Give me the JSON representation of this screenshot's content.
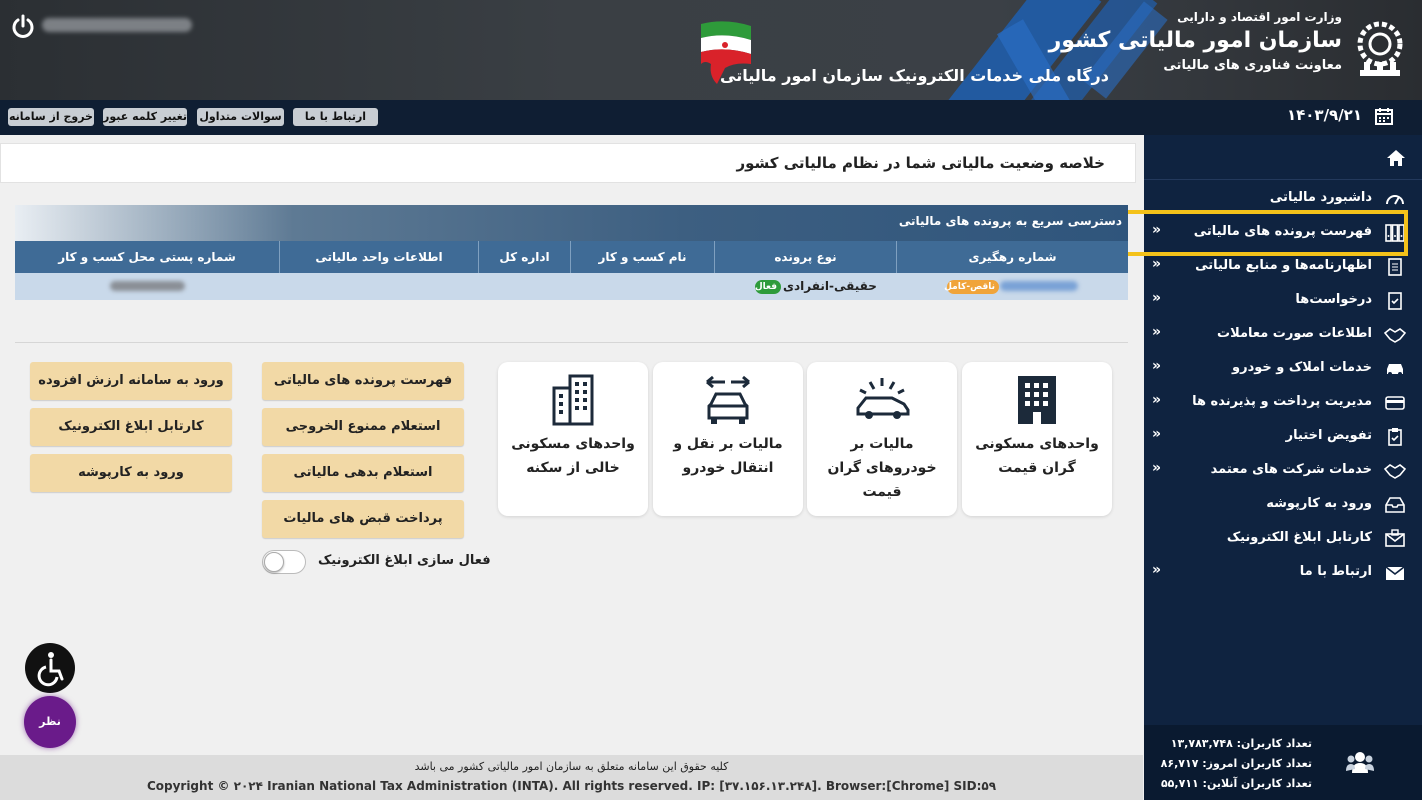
{
  "header": {
    "portal_title": "درگاه ملی خدمات الکترونیک سازمان امور مالیاتی",
    "org_ministry": "وزارت امور اقتصاد و دارایی",
    "org_name": "سازمان امور مالیاتی کشور",
    "org_deputy": "معاونت فناوری های مالیاتی"
  },
  "toolbar": {
    "contact_label": "ارتباط با ما",
    "faq_label": "سوالات متداول",
    "change_password_label": "تغییر کلمه عبور",
    "logout_label": "خروج از سامانه",
    "date": "۱۴۰۳/۹/۲۱"
  },
  "sidebar": {
    "items": [
      {
        "label": "داشبورد مالیاتی",
        "icon": "dashboard-icon",
        "chevron": false
      },
      {
        "label": "فهرست پرونده های مالیاتی",
        "icon": "binders-icon",
        "chevron": true
      },
      {
        "label": "اظهارنامه‌ها و منابع مالیاتی",
        "icon": "document-icon",
        "chevron": true
      },
      {
        "label": "درخواست‌ها",
        "icon": "request-icon",
        "chevron": true
      },
      {
        "label": "اطلاعات صورت معاملات",
        "icon": "handshake-icon",
        "chevron": true
      },
      {
        "label": "خدمات املاک و خودرو",
        "icon": "car-icon",
        "chevron": true
      },
      {
        "label": "مدیریت پرداخت و پذیرنده ها",
        "icon": "card-icon",
        "chevron": true
      },
      {
        "label": "تفویض اختیار",
        "icon": "clipboard-check-icon",
        "chevron": true
      },
      {
        "label": "خدمات شرکت های معتمد",
        "icon": "handshake-icon",
        "chevron": true
      },
      {
        "label": "ورود به کارپوشه",
        "icon": "inbox-icon",
        "chevron": false
      },
      {
        "label": "کارتابل ابلاغ الکترونیک",
        "icon": "mail-lock-icon",
        "chevron": false
      },
      {
        "label": "ارتباط با ما",
        "icon": "envelope-icon",
        "chevron": true
      }
    ],
    "stats": {
      "users_total": "تعداد کاربران: ۱۳,۷۸۳,۷۴۸",
      "users_today": "تعداد کاربران امروز: ۸۶,۷۱۷",
      "users_online": "تعداد کاربران آنلاین: ۵۵,۷۱۱"
    }
  },
  "main": {
    "summary_title": "خلاصه وضعیت مالیاتی شما در نظام مالیاتی کشور",
    "quick_access_title": "دسترسی سریع به پرونده های مالیاتی",
    "table": {
      "columns": [
        "شماره رهگیری",
        "نوع پرونده",
        "نام کسب و کار",
        "اداره کل",
        "اطلاعات واحد مالیاتی",
        "شماره پستی محل کسب و کار"
      ],
      "rows": [
        {
          "status_badge": "ناقص-کامل",
          "case_type": "حقیقی-انفرادی",
          "active_badge": "فعال"
        }
      ]
    },
    "cards": [
      {
        "label": "واحدهای مسکونی گران قیمت",
        "icon": "building-icon"
      },
      {
        "label": "مالیات بر خودروهای گران قیمت",
        "icon": "luxury-car-icon"
      },
      {
        "label": "مالیات بر نقل و انتقال خودرو",
        "icon": "car-transfer-icon"
      },
      {
        "label": "واحدهای مسکونی خالی از سکنه",
        "icon": "apartment-icon"
      }
    ],
    "quick_buttons_col1": [
      "فهرست پرونده های مالیاتی",
      "استعلام ممنوع الخروجی",
      "استعلام بدهی مالیاتی",
      "پرداخت قبض های مالیات"
    ],
    "quick_buttons_col2": [
      "ورود به سامانه ارزش افزوده",
      "کارتابل ابلاغ الکترونیک",
      "ورود به کارپوشه"
    ],
    "toggle_label": "فعال سازی ابلاغ الکترونیک",
    "poll_label": "نظر سنجی"
  },
  "footer": {
    "rights": "کلیه حقوق این سامانه متعلق به سازمان امور مالیاتی کشور می باشد",
    "copyright": "Copyright © ۲۰۲۴ Iranian National Tax Administration (INTA). All rights reserved. IP: [۳۷.۱۵۶.۱۳.۲۴۸]. Browser:[Chrome] SID:۵۹"
  },
  "colors": {
    "sidebar_bg": "#0f2340",
    "toolbar_bg": "#0f1e33",
    "table_header": "#3f6b96",
    "quick_button": "#f2d9a6",
    "highlight": "#f4c21a"
  }
}
